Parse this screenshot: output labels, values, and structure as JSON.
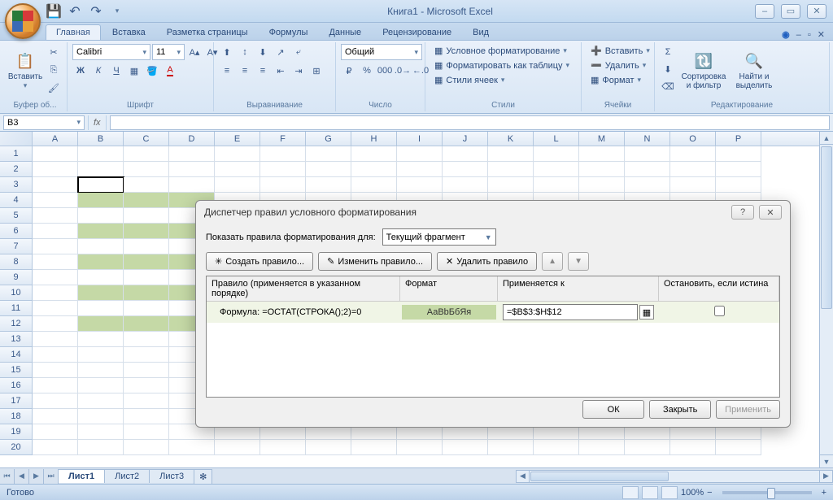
{
  "app": {
    "title": "Книга1 - Microsoft Excel"
  },
  "qat": {
    "save": "💾",
    "undo": "↶",
    "redo": "↷"
  },
  "tabs": {
    "items": [
      "Главная",
      "Вставка",
      "Разметка страницы",
      "Формулы",
      "Данные",
      "Рецензирование",
      "Вид"
    ],
    "active_index": 0
  },
  "ribbon": {
    "clipboard": {
      "label": "Буфер об...",
      "paste": "Вставить"
    },
    "font": {
      "label": "Шрифт",
      "name": "Calibri",
      "size": "11"
    },
    "alignment": {
      "label": "Выравнивание"
    },
    "number": {
      "label": "Число",
      "format": "Общий"
    },
    "styles": {
      "label": "Стили",
      "conditional": "Условное форматирование",
      "as_table": "Форматировать как таблицу",
      "cell_styles": "Стили ячеек"
    },
    "cells": {
      "label": "Ячейки",
      "insert": "Вставить",
      "delete": "Удалить",
      "format": "Формат"
    },
    "editing": {
      "label": "Редактирование",
      "sort": "Сортировка и фильтр",
      "find": "Найти и выделить"
    }
  },
  "namebox": {
    "value": "B3"
  },
  "fx_label": "fx",
  "columns": [
    "A",
    "B",
    "C",
    "D",
    "E",
    "F",
    "G",
    "H",
    "I",
    "J",
    "K",
    "L",
    "M",
    "N",
    "O",
    "P"
  ],
  "row_count": 20,
  "striped_rows": [
    4,
    6,
    8,
    10,
    12
  ],
  "striped_cols_start": 1,
  "striped_cols_end": 3,
  "dialog": {
    "title": "Диспетчер правил условного форматирования",
    "show_rules_for_label": "Показать правила форматирования для:",
    "show_rules_selected": "Текущий фрагмент",
    "new_rule": "Создать правило...",
    "edit_rule": "Изменить правило...",
    "delete_rule": "Удалить правило",
    "col_rule": "Правило (применяется в указанном порядке)",
    "col_format": "Формат",
    "col_applies": "Применяется к",
    "col_stop": "Остановить, если истина",
    "rule_text": "Формула: =ОСТАТ(СТРОКА();2)=0",
    "preview": "АаВbБбЯя",
    "applies_to": "=$B$3:$H$12",
    "ok": "ОК",
    "close": "Закрыть",
    "apply": "Применить"
  },
  "sheets": {
    "items": [
      "Лист1",
      "Лист2",
      "Лист3"
    ],
    "active_index": 0
  },
  "status": {
    "ready": "Готово",
    "zoom": "100%"
  }
}
